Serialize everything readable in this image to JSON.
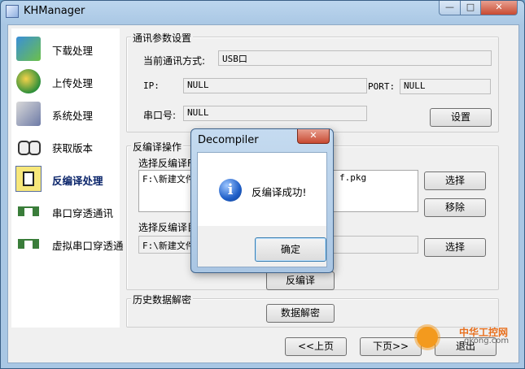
{
  "window": {
    "title": "KHManager",
    "min_glyph": "—",
    "max_glyph": "□",
    "close_glyph": "✕"
  },
  "sidebar": {
    "items": [
      {
        "label": "下载处理",
        "icon": "download-icon",
        "active": false
      },
      {
        "label": "上传处理",
        "icon": "upload-icon",
        "active": false
      },
      {
        "label": "系统处理",
        "icon": "system-icon",
        "active": false
      },
      {
        "label": "获取版本",
        "icon": "chain-icon",
        "active": false
      },
      {
        "label": "反编译处理",
        "icon": "decompile-icon",
        "active": true
      },
      {
        "label": "串口穿透通讯",
        "icon": "network-icon",
        "active": false
      },
      {
        "label": "虚拟串口穿透通",
        "icon": "network-icon",
        "active": false
      }
    ]
  },
  "comm": {
    "legend": "通讯参数设置",
    "mode_label": "当前通讯方式:",
    "mode_value": "USB口",
    "ip_label": "IP:",
    "ip_value": "NULL",
    "port_label": "PORT:",
    "port_value": "NULL",
    "serial_label": "串口号:",
    "serial_value": "NULL",
    "set_button": "设置"
  },
  "decompile": {
    "legend": "反编译操作",
    "file_label": "选择反编译F",
    "file_value_left": "F:\\新建文件",
    "file_value_right": "f.pkg",
    "select_button": "选择",
    "remove_button": "移除",
    "dir_label": "选择反编译目",
    "dir_value": "F:\\新建文件",
    "dir_select_button": "选择",
    "run_button": "反编译"
  },
  "history": {
    "legend": "历史数据解密",
    "decrypt_button": "数据解密"
  },
  "footer": {
    "prev_button": "<<上页",
    "next_button": "下页>>",
    "exit_button": "退出"
  },
  "dialog": {
    "title": "Decompiler",
    "message": "反编译成功!",
    "ok_button": "确定",
    "close_glyph": "✕",
    "icon": "info-icon",
    "icon_glyph": "i"
  },
  "watermark": {
    "text": "中华工控网",
    "url": "gkong.com"
  }
}
